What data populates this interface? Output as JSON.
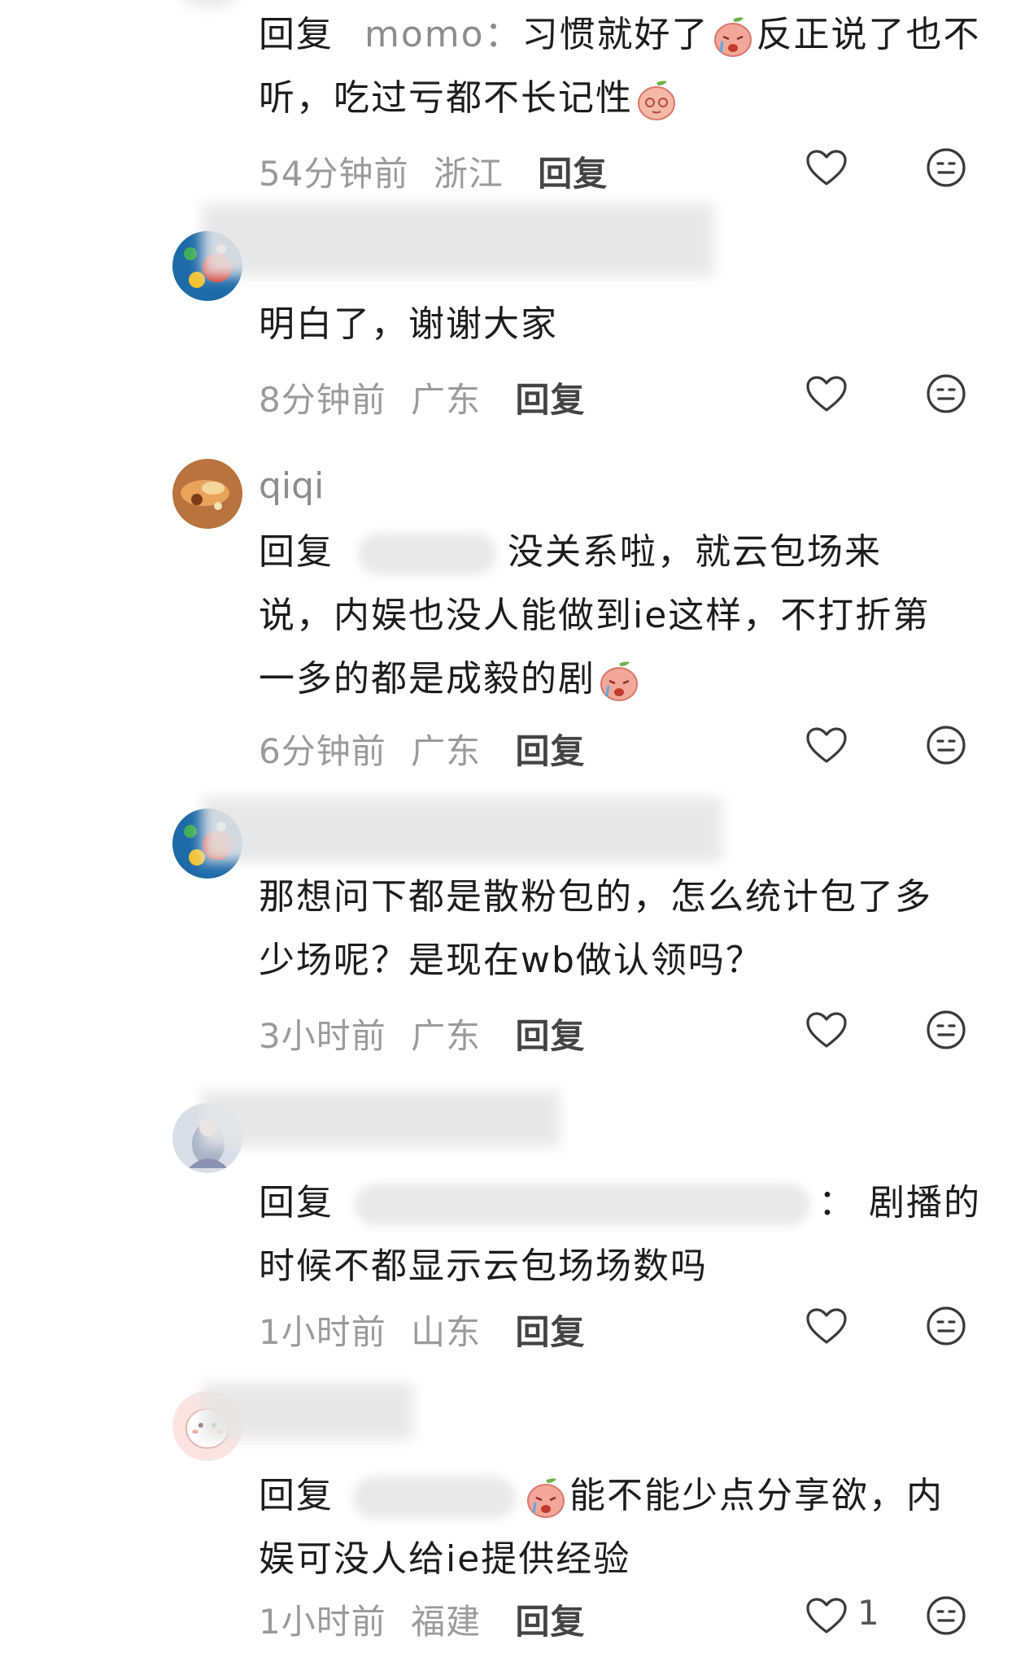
{
  "comments": [
    {
      "reply_label": "回复",
      "reply_to": "momo",
      "colon": "：",
      "text_a": "习惯就好了",
      "text_b": "反正说了也不听，吃过亏都不长记性",
      "time": "54分钟前",
      "location": "浙江",
      "reply_btn": "回复"
    },
    {
      "text": "明白了，谢谢大家",
      "time": "8分钟前",
      "location": "广东",
      "reply_btn": "回复"
    },
    {
      "username": "qiqi",
      "reply_label": "回复",
      "text_a": "没关系啦，就云包场来",
      "text_b": "说，内娱也没人能做到ie这样，不打折第",
      "text_c": "一多的都是成毅的剧",
      "time": "6分钟前",
      "location": "广东",
      "reply_btn": "回复"
    },
    {
      "text_a": "那想问下都是散粉包的，怎么统计包了多",
      "text_b": "少场呢？是现在wb做认领吗？",
      "time": "3小时前",
      "location": "广东",
      "reply_btn": "回复"
    },
    {
      "reply_label": "回复",
      "text_a": "：  剧播的",
      "text_b": "时候不都显示云包场场数吗",
      "time": "1小时前",
      "location": "山东",
      "reply_btn": "回复"
    },
    {
      "reply_label": "回复",
      "text_a": "能不能少点分享欲，内",
      "text_b": "娱可没人给ie提供经验",
      "time": "1小时前",
      "location": "福建",
      "reply_btn": "回复",
      "like_count": "1"
    }
  ],
  "icons": {
    "like": "heart-outline-icon",
    "react": "face-emoji-icon"
  },
  "colors": {
    "text": "#1c1c1c",
    "meta": "#9a9a9a",
    "username": "#8c8c8c"
  }
}
